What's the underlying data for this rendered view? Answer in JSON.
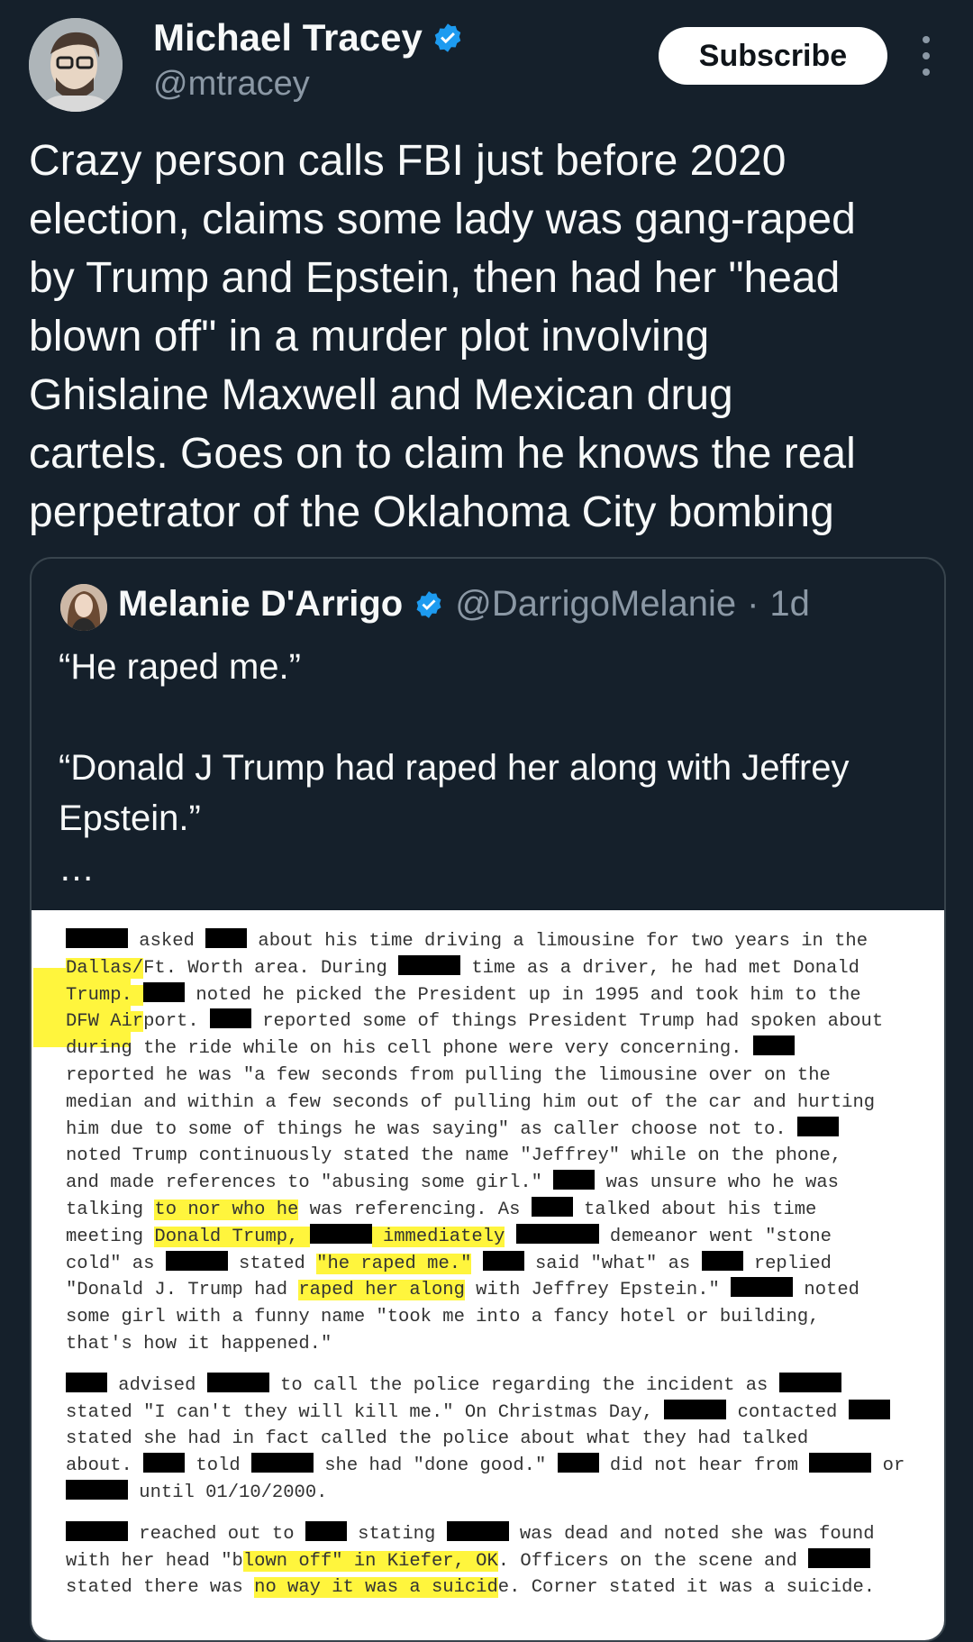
{
  "author": {
    "name": "Michael Tracey",
    "handle": "@mtracey",
    "verified_icon": "verified-badge-icon",
    "subscribe_label": "Subscribe"
  },
  "tweet": {
    "text": "Crazy person calls FBI just before 2020\nelection, claims some lady was gang-raped\nby Trump and Epstein, then had her \"head\nblown off\" in a murder plot involving\nGhislaine Maxwell and Mexican drug\ncartels. Goes on to claim he knows the real\nperpetrator of the Oklahoma City bombing"
  },
  "quoted": {
    "name": "Melanie D'Arrigo",
    "handle": "@DarrigoMelanie",
    "separator": "·",
    "time": "1d",
    "text": "“He raped me.”\n\n“Donald J Trump had raped her along with Jeffrey\nEpstein.”\n…"
  },
  "document": {
    "lines": [
      [
        {
          "r": 3
        },
        {
          "t": " asked "
        },
        {
          "r": 2
        },
        {
          "t": " about his time driving a limousine for two years in the"
        }
      ],
      [
        {
          "h": "Dallas/"
        },
        {
          "t": "Ft. Worth area. During "
        },
        {
          "r": 3
        },
        {
          "t": " time as a driver, he had met Donald"
        }
      ],
      [
        {
          "h": "Trump. "
        },
        {
          "r": 2
        },
        {
          "t": " noted he picked the President up in 1995 and took him to the"
        }
      ],
      [
        {
          "h": "DFW Air"
        },
        {
          "t": "port. "
        },
        {
          "r": 2
        },
        {
          "t": " reported some of things President Trump had spoken about"
        }
      ],
      [
        {
          "t": "during the ride while on his cell phone were very concerning. "
        },
        {
          "r": 2
        }
      ],
      [
        {
          "t": "reported he was \"a few seconds from pulling the limousine over on the"
        }
      ],
      [
        {
          "t": "median and within a few seconds of pulling him out of the car and hurting"
        }
      ],
      [
        {
          "t": "him due to some of things he was saying\" as caller choose not to. "
        },
        {
          "r": 2
        }
      ],
      [
        {
          "t": "noted Trump continuously stated the name \"Jeffrey\" while on the phone,"
        }
      ],
      [
        {
          "t": "and made references to \"abusing some girl.\" "
        },
        {
          "r": 2
        },
        {
          "t": " was unsure who he was"
        }
      ],
      [
        {
          "t": "talking "
        },
        {
          "h": "to nor who he"
        },
        {
          "t": " was referencing. As "
        },
        {
          "r": 2
        },
        {
          "t": " talked about his time"
        }
      ],
      [
        {
          "t": "meeting "
        },
        {
          "h": "Donald Trump, "
        },
        {
          "r": 3
        },
        {
          "h": " immediately"
        },
        {
          "t": " "
        },
        {
          "r": 4
        },
        {
          "t": " demeanor went \"stone"
        }
      ],
      [
        {
          "t": "cold\" as "
        },
        {
          "r": 3
        },
        {
          "t": " stated "
        },
        {
          "h": "\"he raped me.\""
        },
        {
          "t": " "
        },
        {
          "r": 2
        },
        {
          "t": " said \"what\" as "
        },
        {
          "r": 2
        },
        {
          "t": " replied"
        }
      ],
      [
        {
          "t": "\"Donald J. Trump had "
        },
        {
          "h": "raped her along"
        },
        {
          "t": " with Jeffrey Epstein.\" "
        },
        {
          "r": 3
        },
        {
          "t": " noted"
        }
      ],
      [
        {
          "t": "some girl with a funny name \"took me into a fancy hotel or building,"
        }
      ],
      [
        {
          "t": "that's how it happened.\""
        }
      ],
      [
        {
          "t": ""
        }
      ],
      [
        {
          "r": 2
        },
        {
          "t": " advised "
        },
        {
          "r": 3
        },
        {
          "t": " to call the police regarding the incident as "
        },
        {
          "r": 3
        }
      ],
      [
        {
          "t": "stated \"I can't they will kill me.\" On Christmas Day, "
        },
        {
          "r": 3
        },
        {
          "t": " contacted "
        },
        {
          "r": 2
        }
      ],
      [
        {
          "t": "stated she had in fact called the police about what they had talked"
        }
      ],
      [
        {
          "t": "about. "
        },
        {
          "r": 2
        },
        {
          "t": " told "
        },
        {
          "r": 3
        },
        {
          "t": " she had \"done good.\" "
        },
        {
          "r": 2
        },
        {
          "t": " did not hear from "
        },
        {
          "r": 3
        },
        {
          "t": " or"
        }
      ],
      [
        {
          "r": 3
        },
        {
          "t": " until 01/10/2000."
        }
      ],
      [
        {
          "t": ""
        }
      ],
      [
        {
          "r": 3
        },
        {
          "t": " reached out to "
        },
        {
          "r": 2
        },
        {
          "t": " stating "
        },
        {
          "r": 3
        },
        {
          "t": " was dead and noted she was found"
        }
      ],
      [
        {
          "t": "with her head \"b"
        },
        {
          "h": "lown off\" in Kiefer, OK"
        },
        {
          "t": ". Officers on the scene and "
        },
        {
          "r": 3
        }
      ],
      [
        {
          "t": "stated there was "
        },
        {
          "h": "no way it was a suicid"
        },
        {
          "t": "e. Corner stated it was a suicide."
        }
      ]
    ]
  }
}
